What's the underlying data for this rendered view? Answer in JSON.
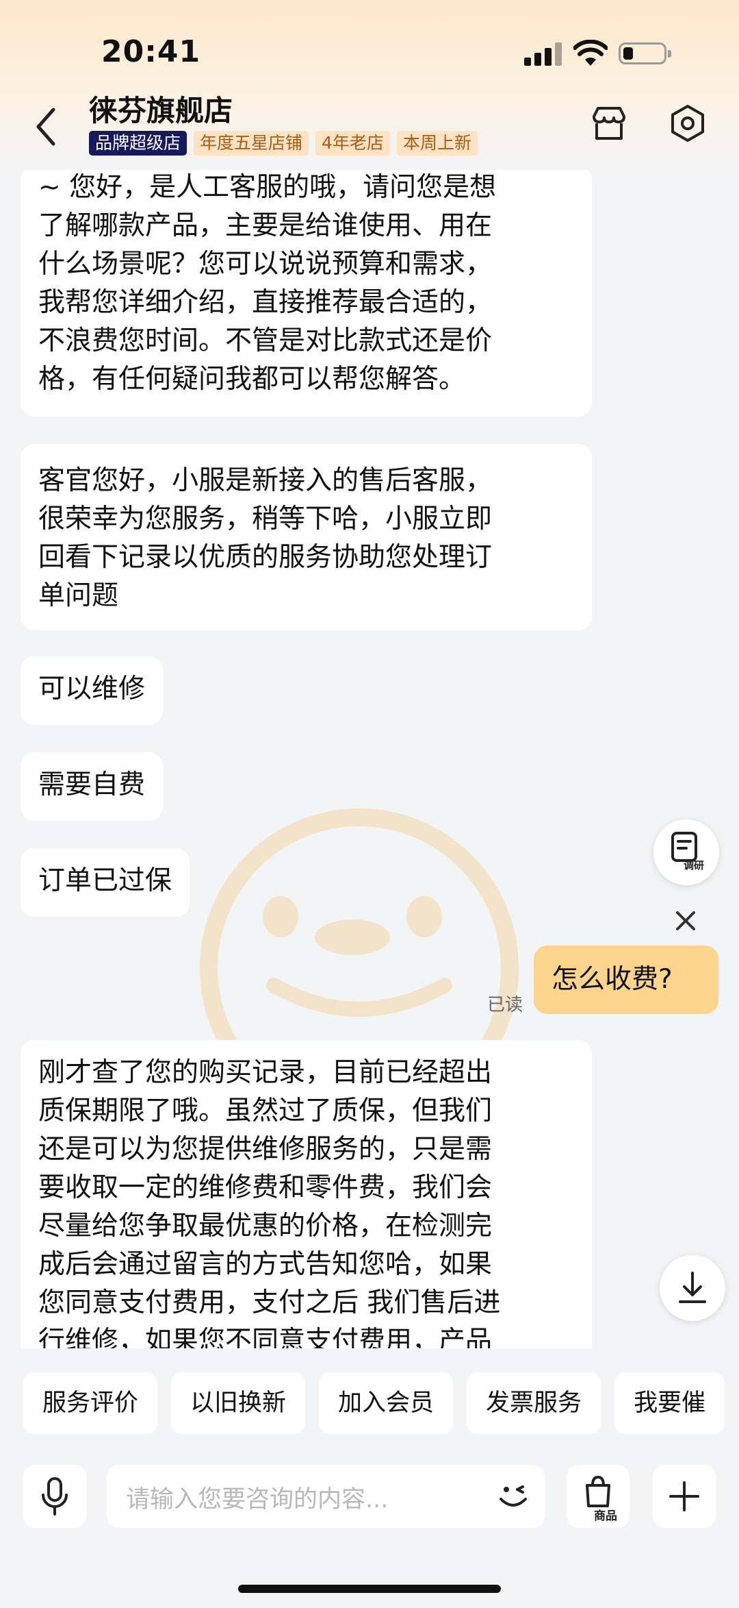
{
  "status_bar": {
    "time": "20:41"
  },
  "header": {
    "title": "徕芬旗舰店",
    "tags": [
      "品牌超级店",
      "年度五星店铺",
      "4年老店",
      "本周上新"
    ]
  },
  "messages": [
    {
      "from": "agent",
      "text": "~ 您好，是人工客服的哦，请问您是想\n了解哪款产品，主要是给谁使用、用在\n什么场景呢？您可以说说预算和需求，\n我帮您详细介绍，直接推荐最合适的，\n不浪费您时间。不管是对比款式还是价\n格，有任何疑问我都可以帮您解答。"
    },
    {
      "from": "agent",
      "text": "客官您好，小服是新接入的售后客服，\n很荣幸为您服务，稍等下哈，小服立即\n回看下记录以优质的服务协助您处理订\n单问题"
    },
    {
      "from": "agent",
      "text": "可以维修"
    },
    {
      "from": "agent",
      "text": "需要自费"
    },
    {
      "from": "agent",
      "text": "订单已过保"
    },
    {
      "from": "user",
      "text": "怎么收费?",
      "status": "已读"
    },
    {
      "from": "agent",
      "text": "刚才查了您的购买记录，目前已经超出\n质保期限了哦。虽然过了质保，但我们\n还是可以为您提供维修服务的，只是需\n要收取一定的维修费和零件费，我们会\n尽量给您争取最优惠的价格，在检测完\n成后会通过留言的方式告知您哈，如果\n您同意支付费用，支付之后 我们售后进\n行维修，如果您不同意支付费用，产品"
    }
  ],
  "float_buttons": {
    "survey_label": "调研"
  },
  "quick_replies": [
    "服务评价",
    "以旧换新",
    "加入会员",
    "发票服务",
    "我要催"
  ],
  "input": {
    "placeholder": "请输入您要咨询的内容...",
    "goods_label": "商品"
  },
  "colors": {
    "accent": "#fcd48e",
    "brand_tag": "#161a5a",
    "gold_tag_bg": "#fde3c4",
    "watermark": "#f2b24a"
  }
}
